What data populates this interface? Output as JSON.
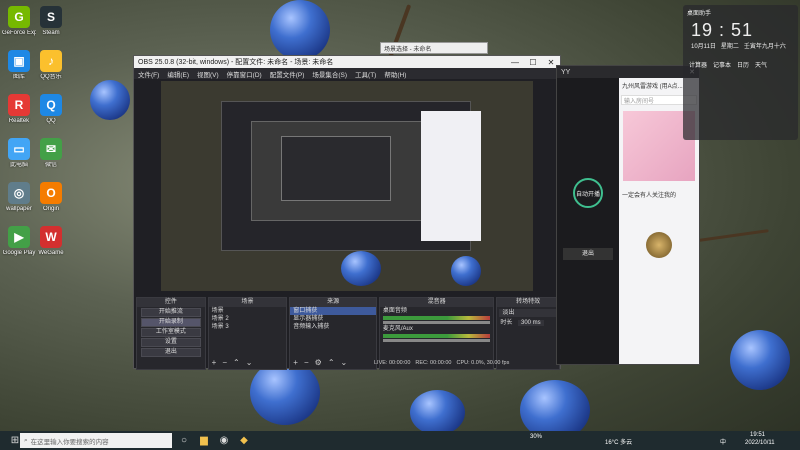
{
  "desktop_icons": [
    {
      "label": "GeForce Experience",
      "color": "#76b900",
      "glyph": "G",
      "icon": "geforce-icon"
    },
    {
      "label": "图库",
      "color": "#1e88e5",
      "glyph": "▣",
      "icon": "gallery-icon"
    },
    {
      "label": "Realtek",
      "color": "#e53935",
      "glyph": "R",
      "icon": "realtek-icon"
    },
    {
      "label": "此电脑",
      "color": "#42a5f5",
      "glyph": "▭",
      "icon": "computer-icon"
    },
    {
      "label": "wallpaper",
      "color": "#607d8b",
      "glyph": "◎",
      "icon": "wallpaper-icon"
    },
    {
      "label": "Google Play",
      "color": "#43a047",
      "glyph": "▶",
      "icon": "play-icon"
    },
    {
      "label": "Steam",
      "color": "#263238",
      "glyph": "S",
      "icon": "steam-icon"
    },
    {
      "label": "QQ音乐",
      "color": "#fbc02d",
      "glyph": "♪",
      "icon": "music-icon"
    },
    {
      "label": "QQ",
      "color": "#1e88e5",
      "glyph": "Q",
      "icon": "qq-icon"
    },
    {
      "label": "微信",
      "color": "#43a047",
      "glyph": "✉",
      "icon": "wechat-icon"
    },
    {
      "label": "Origin",
      "color": "#f57c00",
      "glyph": "O",
      "icon": "origin-icon"
    },
    {
      "label": "WeGame",
      "color": "#d32f2f",
      "glyph": "W",
      "icon": "wegame-icon"
    }
  ],
  "obs": {
    "title": "OBS 25.0.8 (32-bit, windows) - 配置文件: 未命名 - 场景: 未命名",
    "menu": [
      "文件(F)",
      "编辑(E)",
      "视图(V)",
      "停靠窗口(D)",
      "配置文件(P)",
      "场景集合(S)",
      "工具(T)",
      "帮助(H)"
    ],
    "docks": {
      "controls": {
        "title": "控件",
        "buttons": [
          "开始推流",
          "开始录制",
          "工作室模式",
          "设置",
          "退出"
        ]
      },
      "scenes": {
        "title": "场景",
        "items": [
          "场景",
          "场景 2",
          "场景 3"
        ]
      },
      "sources": {
        "title": "来源",
        "items": [
          "窗口捕获",
          "显示器捕获",
          "音频输入捕获"
        ]
      },
      "mixer": {
        "title": "混音器",
        "channels": [
          "桌面音频",
          "麦克风/Aux"
        ],
        "levels": [
          "0.0 dB",
          "0.0 dB"
        ]
      },
      "transitions": {
        "title": "转场特效",
        "type": "淡出",
        "duration_label": "时长",
        "duration": "300 ms"
      }
    },
    "status": {
      "live": "LIVE: 00:00:00",
      "rec": "REC: 00:00:00",
      "cpu": "CPU: 0.0%, 30.00 fps"
    }
  },
  "floating": {
    "title": "场景选择 - 未命名"
  },
  "yy": {
    "title": "YY",
    "search": "输入房间号",
    "button": "退出",
    "status": "自动开播",
    "panel_title": "九州风雷游戏 (用A点...",
    "notice": "一定会有人关注我的"
  },
  "clock": {
    "title": "桌面助手",
    "time": "19 : 51",
    "date": "10月11日",
    "weekday": "星期二",
    "lunar": "壬寅年九月十六",
    "shortcuts": [
      "计算器",
      "记事本",
      "日历",
      "天气"
    ]
  },
  "taskbar": {
    "search_placeholder": "在这里输入你要搜索的内容",
    "battery": "30%",
    "weather": "16°C 多云",
    "ime": "中",
    "time": "19:51",
    "date": "2022/10/11"
  }
}
